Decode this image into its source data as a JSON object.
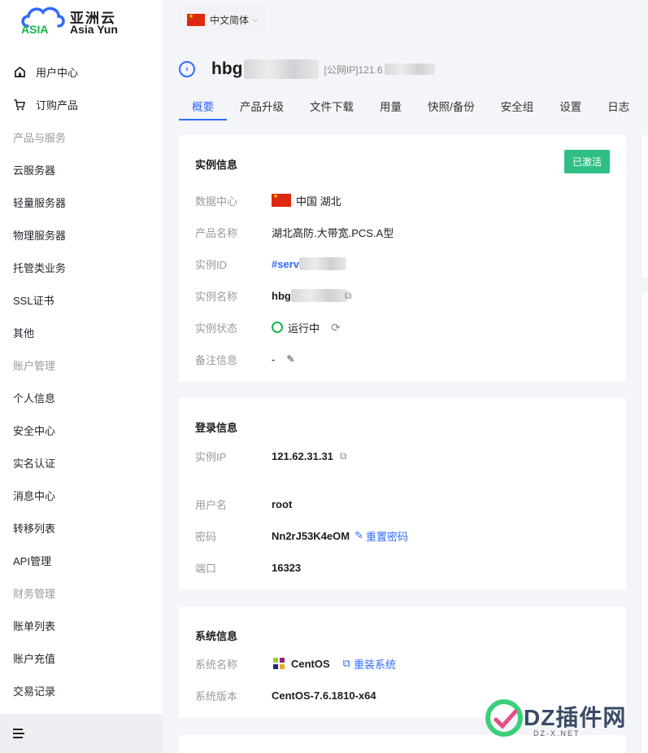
{
  "logo": {
    "cn": "亚洲云",
    "en": "Asia Yun",
    "badge": "ASIA"
  },
  "sidebar": {
    "items": [
      {
        "type": "item",
        "label": "用户中心",
        "icon": "home-icon"
      },
      {
        "type": "item",
        "label": "订购产品",
        "icon": "cart-icon"
      },
      {
        "type": "group",
        "label": "产品与服务"
      },
      {
        "type": "item",
        "label": "云服务器"
      },
      {
        "type": "item",
        "label": "轻量服务器"
      },
      {
        "type": "item",
        "label": "物理服务器"
      },
      {
        "type": "item",
        "label": "托管类业务"
      },
      {
        "type": "item",
        "label": "SSL证书"
      },
      {
        "type": "item",
        "label": "其他"
      },
      {
        "type": "group",
        "label": "账户管理"
      },
      {
        "type": "item",
        "label": "个人信息"
      },
      {
        "type": "item",
        "label": "安全中心"
      },
      {
        "type": "item",
        "label": "实名认证"
      },
      {
        "type": "item",
        "label": "消息中心"
      },
      {
        "type": "item",
        "label": "转移列表"
      },
      {
        "type": "item",
        "label": "API管理"
      },
      {
        "type": "group",
        "label": "财务管理"
      },
      {
        "type": "item",
        "label": "账单列表"
      },
      {
        "type": "item",
        "label": "账户充值"
      },
      {
        "type": "item",
        "label": "交易记录"
      }
    ]
  },
  "topbar": {
    "language": "中文简体"
  },
  "header": {
    "host_prefix": "hbg",
    "public_ip_label": "[公网IP]121.6"
  },
  "tabs": [
    "概要",
    "产品升级",
    "文件下载",
    "用量",
    "快照/备份",
    "安全组",
    "设置",
    "日志"
  ],
  "instance": {
    "title": "实例信息",
    "status_badge": "已激活",
    "datacenter_label": "数据中心",
    "datacenter": "中国 湖北",
    "product_label": "产品名称",
    "product": "湖北高防.大带宽.PCS.A型",
    "id_label": "实例ID",
    "id": "#serv",
    "name_label": "实例名称",
    "name": "hbg",
    "state_label": "实例状态",
    "state": "运行中",
    "note_label": "备注信息",
    "note": "-"
  },
  "login": {
    "title": "登录信息",
    "ip_label": "实例IP",
    "ip": "121.62.31.31",
    "user_label": "用户名",
    "user": "root",
    "pwd_label": "密码",
    "pwd": "Nn2rJ53K4eOM",
    "reset_pwd": "重置密码",
    "port_label": "端口",
    "port": "16323"
  },
  "system": {
    "title": "系统信息",
    "os_label": "系统名称",
    "os": "CentOS",
    "reinstall": "重装系统",
    "ver_label": "系统版本",
    "ver": "CentOS-7.6.1810-x64"
  },
  "watermark": {
    "text": "DZ插件网",
    "sub": "DZ-X.NET"
  },
  "colors": {
    "accent": "#2f6bff",
    "success": "#2fbf85",
    "running": "#19b34a"
  }
}
